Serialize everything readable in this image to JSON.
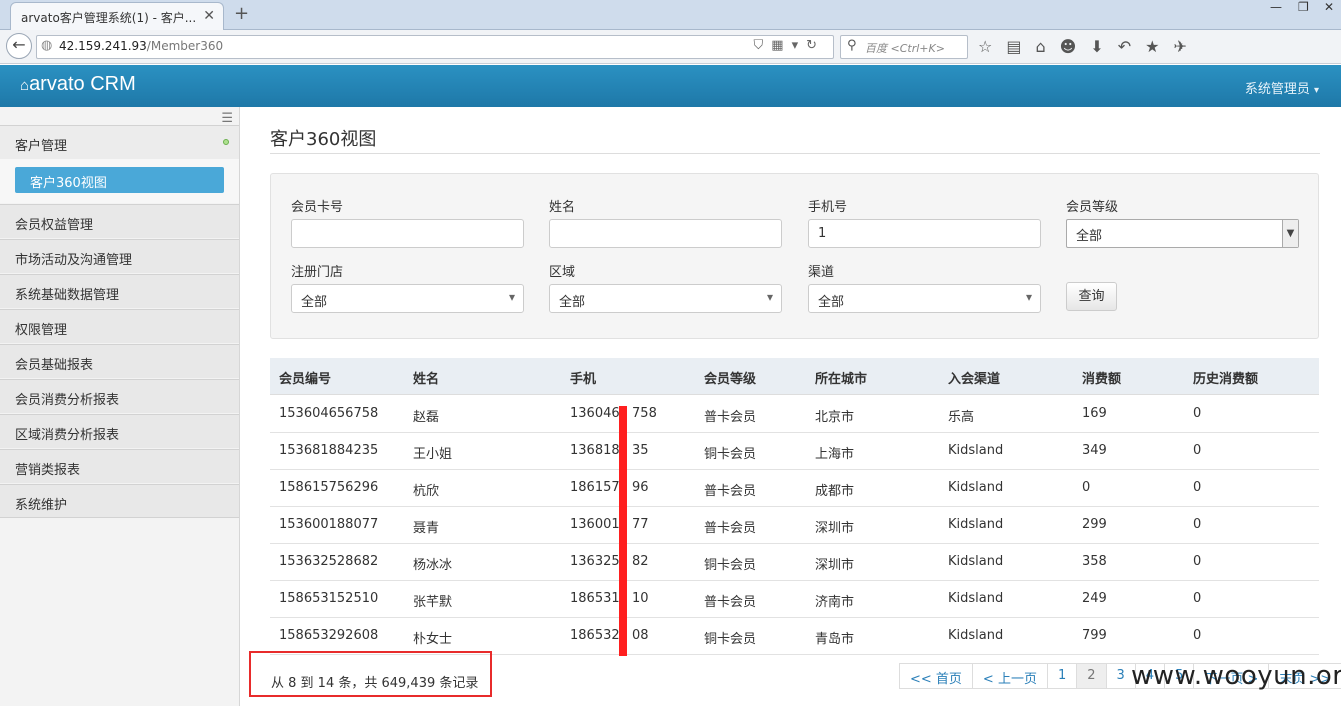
{
  "browser": {
    "tab_title": "arvato客户管理系统(1) - 客户...",
    "url_host": "42.159.241.93",
    "url_path": "/Member360",
    "search_placeholder": "百度 <Ctrl+K>"
  },
  "app": {
    "brand": "arvato CRM",
    "user_menu": "系统管理员"
  },
  "sidebar": {
    "items": [
      {
        "label": "客户管理"
      },
      {
        "label": "会员权益管理"
      },
      {
        "label": "市场活动及沟通管理"
      },
      {
        "label": "系统基础数据管理"
      },
      {
        "label": "权限管理"
      },
      {
        "label": "会员基础报表"
      },
      {
        "label": "会员消费分析报表"
      },
      {
        "label": "区域消费分析报表"
      },
      {
        "label": "营销类报表"
      },
      {
        "label": "系统维护"
      }
    ],
    "sub_active": "客户360视图"
  },
  "page": {
    "title": "客户360视图"
  },
  "filters": {
    "card_no": {
      "label": "会员卡号",
      "value": ""
    },
    "name": {
      "label": "姓名",
      "value": ""
    },
    "phone": {
      "label": "手机号",
      "value": "1"
    },
    "level": {
      "label": "会员等级",
      "value": "全部"
    },
    "store": {
      "label": "注册门店",
      "value": "全部"
    },
    "region": {
      "label": "区域",
      "value": "全部"
    },
    "channel": {
      "label": "渠道",
      "value": "全部"
    },
    "query_label": "查询"
  },
  "table": {
    "headers": [
      "会员编号",
      "姓名",
      "手机",
      "会员等级",
      "所在城市",
      "入会渠道",
      "消费额",
      "历史消费额"
    ],
    "rows": [
      [
        "153604656758",
        "赵磊",
        "1360465 758",
        "普卡会员",
        "北京市",
        "乐高",
        "169",
        "0"
      ],
      [
        "153681884235",
        "王小姐",
        "1368188 35",
        "铜卡会员",
        "上海市",
        "Kidsland",
        "349",
        "0"
      ],
      [
        "158615756296",
        "杭欣",
        "1861575 96",
        "普卡会员",
        "成都市",
        "Kidsland",
        "0",
        "0"
      ],
      [
        "153600188077",
        "聂青",
        "1360018 77",
        "普卡会员",
        "深圳市",
        "Kidsland",
        "299",
        "0"
      ],
      [
        "153632528682",
        "杨冰冰",
        "1363252 82",
        "铜卡会员",
        "深圳市",
        "Kidsland",
        "358",
        "0"
      ],
      [
        "158653152510",
        "张芊默",
        "1865315 10",
        "普卡会员",
        "济南市",
        "Kidsland",
        "249",
        "0"
      ],
      [
        "158653292608",
        "朴女士",
        "1865329 08",
        "铜卡会员",
        "青岛市",
        "Kidsland",
        "799",
        "0"
      ]
    ]
  },
  "footer": {
    "info": "从 8 到 14 条，共 649,439 条记录",
    "pages": [
      "<< 首页",
      "< 上一页",
      "1",
      "2",
      "3",
      "4",
      "5",
      "下一页 >",
      "末页 >>"
    ]
  },
  "watermark": "www.wooyun.org"
}
